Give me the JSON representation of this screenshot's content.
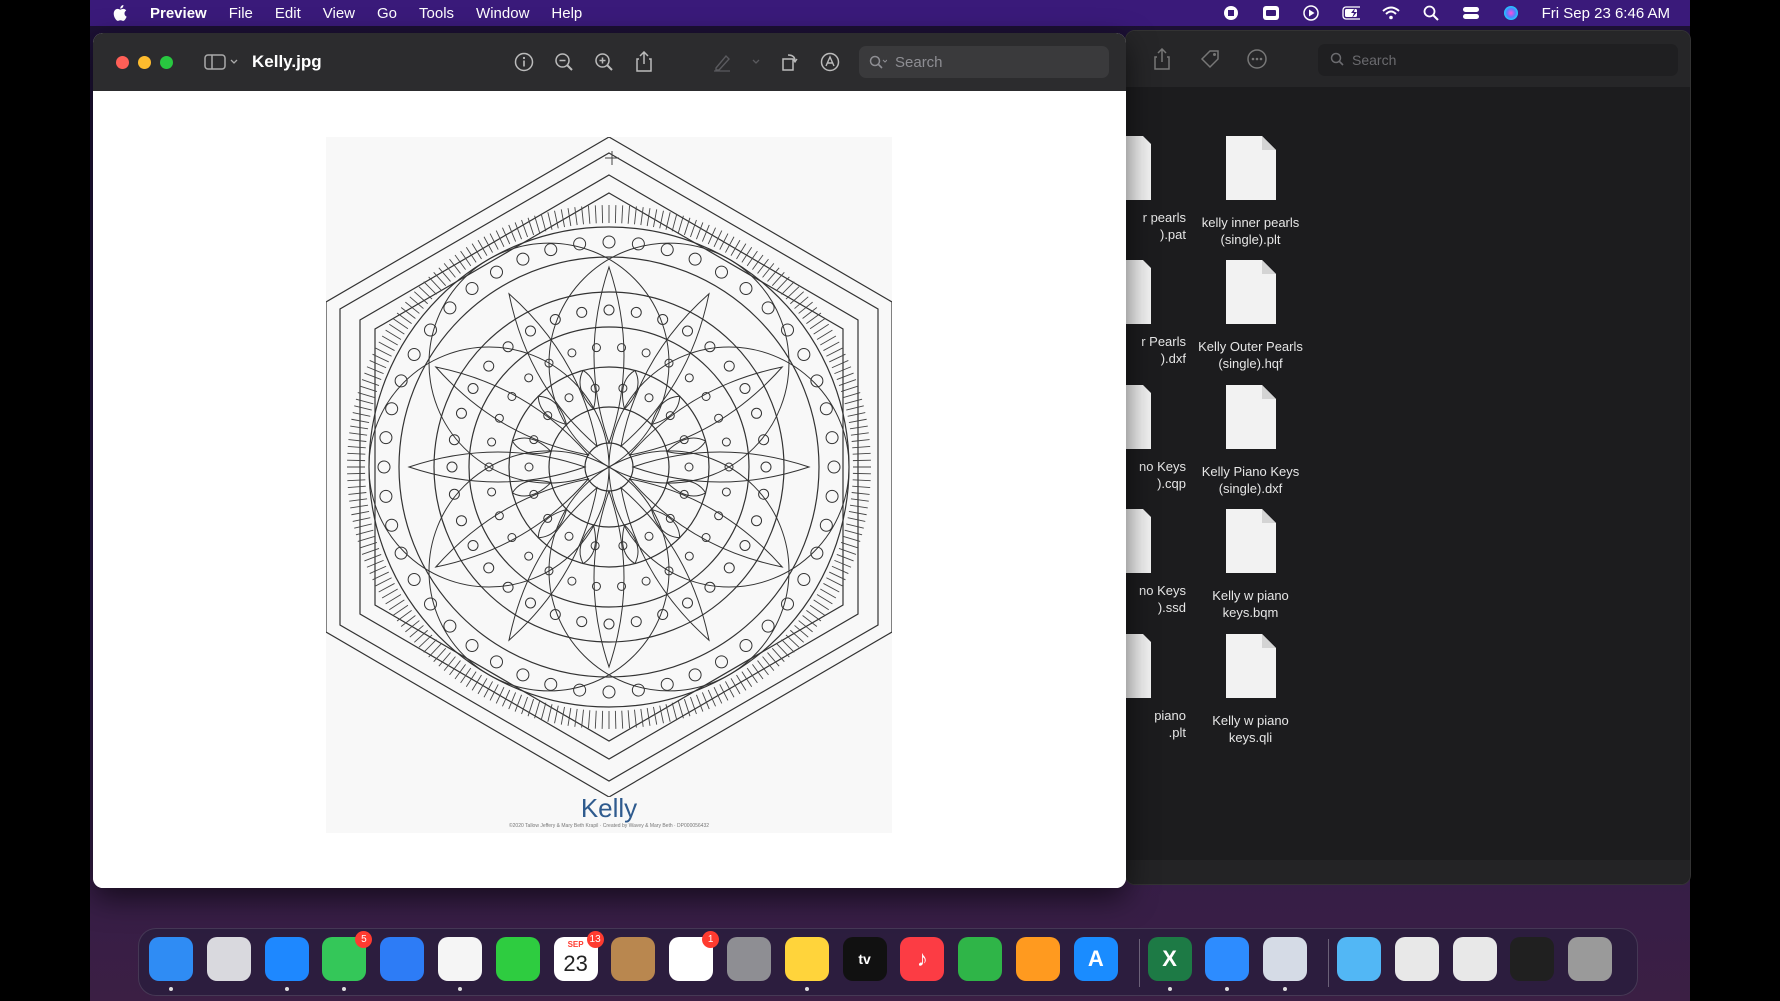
{
  "menubar": {
    "apple_icon": "apple-logo",
    "app_name": "Preview",
    "menus": [
      "File",
      "Edit",
      "View",
      "Go",
      "Tools",
      "Window",
      "Help"
    ],
    "status_icons": [
      "screen-record-icon",
      "caption-icon",
      "play-icon",
      "battery-icon",
      "wifi-icon",
      "spotlight-icon",
      "control-center-icon",
      "siri-icon"
    ],
    "clock": "Fri Sep 23  6:46 AM"
  },
  "preview_window": {
    "title": "Kelly.jpg",
    "toolbar_icons": [
      "info-icon",
      "zoom-out-icon",
      "zoom-in-icon",
      "share-icon",
      "markup-pen-icon",
      "chevron-down-icon",
      "rotate-icon",
      "annotate-icon"
    ],
    "search_placeholder": "Search",
    "image": {
      "caption": "Kelly",
      "credit": "©2020 Tallow Jeffery & Mary Beth Krapil · Created by Wavey & Mary Beth · DP000056432"
    }
  },
  "finder_window": {
    "search_placeholder": "Search",
    "toolbar_icons": [
      "share-icon",
      "tag-icon",
      "more-icon"
    ],
    "partial_labels": [
      [
        "r pearls",
        ").pat"
      ],
      [
        "r Pearls",
        ").dxf"
      ],
      [
        "no Keys",
        ").cqp"
      ],
      [
        "no Keys",
        ").ssd"
      ],
      [
        "piano",
        ".plt"
      ]
    ],
    "files": [
      [
        "kelly inner pearls",
        "(single).plt"
      ],
      [
        "Kelly Outer Pearls",
        "(single).hqf"
      ],
      [
        "Kelly Piano Keys",
        "(single).dxf"
      ],
      [
        "Kelly w piano",
        "keys.bqm"
      ],
      [
        "Kelly w piano",
        "keys.qli"
      ]
    ]
  },
  "dock": {
    "apps": [
      {
        "name": "Finder",
        "color": "#2f8cf4",
        "glyph": "",
        "running": true
      },
      {
        "name": "Launchpad",
        "color": "#d9d9de",
        "glyph": "",
        "running": false
      },
      {
        "name": "Safari",
        "color": "#1e88ff",
        "glyph": "",
        "running": true
      },
      {
        "name": "Messages",
        "color": "#34c759",
        "glyph": "",
        "running": true,
        "badge": "5"
      },
      {
        "name": "Mail",
        "color": "#2d7cf6",
        "glyph": "",
        "running": false
      },
      {
        "name": "Photos",
        "color": "#f5f5f5",
        "glyph": "",
        "running": true
      },
      {
        "name": "FaceTime",
        "color": "#2ecc40",
        "glyph": "",
        "running": false
      },
      {
        "name": "Calendar",
        "color": "#ffffff",
        "glyph": "23",
        "running": false,
        "badge": "13",
        "month": "SEP"
      },
      {
        "name": "Contacts",
        "color": "#b9874f",
        "glyph": "",
        "running": false
      },
      {
        "name": "Reminders",
        "color": "#ffffff",
        "glyph": "",
        "running": false,
        "badge": "1"
      },
      {
        "name": "System Preferences",
        "color": "#8e8e93",
        "glyph": "",
        "running": false
      },
      {
        "name": "Notes",
        "color": "#ffd43b",
        "glyph": "",
        "running": true
      },
      {
        "name": "TV",
        "color": "#111111",
        "glyph": "tv",
        "running": false
      },
      {
        "name": "Music",
        "color": "#fc3c44",
        "glyph": "♪",
        "running": false
      },
      {
        "name": "Numbers",
        "color": "#2fb548",
        "glyph": "",
        "running": false
      },
      {
        "name": "Pages",
        "color": "#ff9a1f",
        "glyph": "",
        "running": false
      },
      {
        "name": "App Store",
        "color": "#1a8cff",
        "glyph": "A",
        "running": false
      },
      {
        "name": "Excel",
        "color": "#1d7a45",
        "glyph": "X",
        "running": true
      },
      {
        "name": "Zoom",
        "color": "#2d8cff",
        "glyph": "",
        "running": true
      },
      {
        "name": "Preview",
        "color": "#d5dbe6",
        "glyph": "",
        "running": true
      },
      {
        "name": "Downloads",
        "color": "#52b7f5",
        "glyph": "",
        "running": false
      },
      {
        "name": "Recent 1",
        "color": "#e8e8e8",
        "glyph": "",
        "running": false
      },
      {
        "name": "Recent 2",
        "color": "#e8e8e8",
        "glyph": "",
        "running": false
      },
      {
        "name": "Recent 3",
        "color": "#202020",
        "glyph": "",
        "running": false
      },
      {
        "name": "Trash",
        "color": "#9a9a9a",
        "glyph": "",
        "running": false
      }
    ]
  }
}
